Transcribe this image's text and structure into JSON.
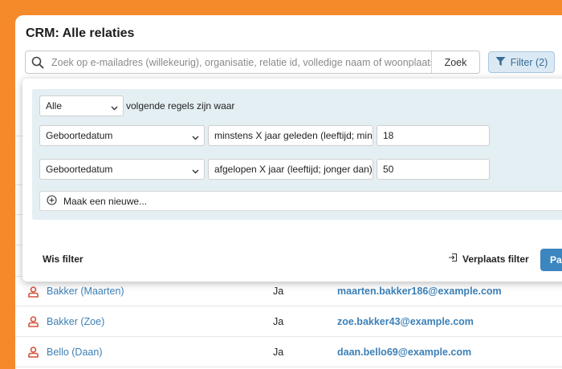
{
  "app": {
    "title": "CRM: Alle relaties"
  },
  "search": {
    "placeholder": "Zoek op e-mailadres (willekeurig), organisatie, relatie id, volledige naam of woonplaats…",
    "button_label": "Zoek"
  },
  "filter_button": {
    "label": "Filter (2)",
    "icon": "funnel-icon"
  },
  "filter_panel": {
    "match_mode": "Alle",
    "match_suffix": "volgende regels zijn waar",
    "rules": [
      {
        "field": "Geboortedatum",
        "operator": "minstens X jaar geleden (leeftijd; minimaal)",
        "value": "18"
      },
      {
        "field": "Geboortedatum",
        "operator": "afgelopen X jaar (leeftijd; jonger dan)",
        "value": "50"
      }
    ],
    "add_label": "Maak een nieuwe...",
    "clear_label": "Wis filter",
    "move_label": "Verplaats filter",
    "apply_label": "Pas"
  },
  "contacts": [
    {
      "name": "Bakker (Maarten)",
      "flag": "Ja",
      "email": "maarten.bakker186@example.com"
    },
    {
      "name": "Bakker (Zoe)",
      "flag": "Ja",
      "email": "zoe.bakker43@example.com"
    },
    {
      "name": "Bello (Daan)",
      "flag": "Ja",
      "email": "daan.bello69@example.com"
    }
  ],
  "colors": {
    "background": "#f58a2b",
    "link": "#3b7fb6",
    "rules_background": "#e4eff3",
    "primary_button": "#3b86bf",
    "person_icon": "#d4533b"
  }
}
